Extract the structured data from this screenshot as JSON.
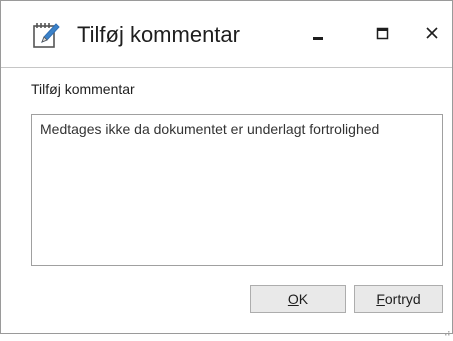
{
  "window": {
    "title": "Tilføj kommentar",
    "icon": "notepad-pencil-icon",
    "controls": {
      "minimize_icon": "minimize-icon",
      "maximize_icon": "maximize-icon",
      "close_icon": "close-icon"
    }
  },
  "form": {
    "label": "Tilføj kommentar",
    "comment_value": "Medtages ikke da dokumentet er underlagt fortrolighed"
  },
  "buttons": {
    "ok": {
      "mnemonic": "O",
      "rest": "K"
    },
    "cancel": {
      "mnemonic": "F",
      "rest": "ortryd"
    }
  },
  "colors": {
    "icon_blue": "#2f6fb5",
    "text": "#1e1e1e",
    "button_bg": "#e9e9e9",
    "border": "#a0a0a0"
  }
}
